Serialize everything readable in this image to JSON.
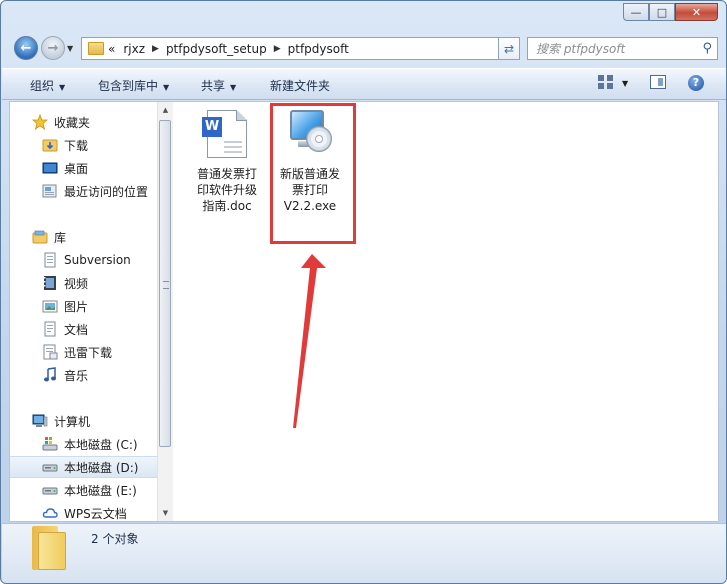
{
  "window": {
    "buttons": {
      "minimize": "—",
      "maximize": "□",
      "close": "✕"
    }
  },
  "address": {
    "overflow": "«",
    "crumbs": [
      "rjxz",
      "ptfpdysoft_setup",
      "ptfpdysoft"
    ]
  },
  "search": {
    "placeholder": "搜索 ptfpdysoft"
  },
  "toolbar": {
    "organize": "组织",
    "include_in_library": "包含到库中",
    "share": "共享",
    "new_folder": "新建文件夹"
  },
  "nav": {
    "favorites": {
      "header": "收藏夹",
      "items": [
        "下载",
        "桌面",
        "最近访问的位置"
      ]
    },
    "libraries": {
      "header": "库",
      "items": [
        "Subversion",
        "视频",
        "图片",
        "文档",
        "迅雷下载",
        "音乐"
      ]
    },
    "computer": {
      "header": "计算机",
      "items": [
        "本地磁盘 (C:)",
        "本地磁盘 (D:)",
        "本地磁盘 (E:)",
        "WPS云文档"
      ],
      "selected": "本地磁盘 (D:)"
    }
  },
  "files": [
    {
      "name": "普通发票打印软件升级指南.doc",
      "line1": "普通发票打",
      "line2": "印软件升级",
      "line3": "指南.doc",
      "icon": "word-doc-icon"
    },
    {
      "name": "新版普通发票打印V2.2.exe",
      "line1": "新版普通发",
      "line2": "票打印",
      "line3": "V2.2.exe",
      "icon": "setup-cd-icon",
      "highlighted": true
    }
  ],
  "status": {
    "count": "2 个对象"
  },
  "colors": {
    "highlight": "#e03a3a",
    "accent": "#2f66c7"
  }
}
